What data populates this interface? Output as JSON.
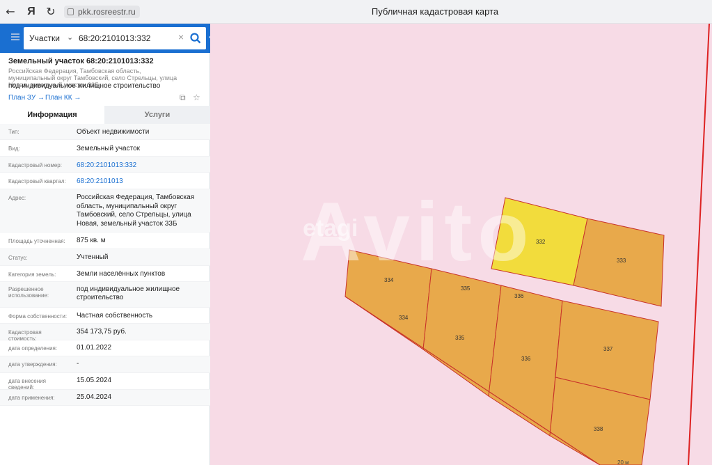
{
  "browser": {
    "url": "pkk.rosreestr.ru",
    "page_title": "Публичная кадастровая карта"
  },
  "search": {
    "type": "Участки",
    "value": "68:20:2101013:332"
  },
  "object": {
    "title": "Земельный участок 68:20:2101013:332",
    "address": "Российская Федерация, Тамбовская область, муниципальный округ Тамбовский, село Стрельцы, улица Новая, земельный участок 33Б",
    "use": "под индивидуальное жилищное строительство",
    "plan_zu": "План ЗУ →",
    "plan_kk": "План КК →"
  },
  "tabs": {
    "info": "Информация",
    "services": "Услуги"
  },
  "fields": [
    {
      "label": "Тип:",
      "value": "Объект недвижимости"
    },
    {
      "label": "Вид:",
      "value": "Земельный участок"
    },
    {
      "label": "Кадастровый номер:",
      "value": "68:20:2101013:332"
    },
    {
      "label": "Кадастровый квартал:",
      "value": "68:20:2101013"
    },
    {
      "label": "Адрес:",
      "value": "Российская Федерация, Тамбовская область, муниципальный округ Тамбовский, село Стрельцы, улица Новая, земельный участок 33Б"
    },
    {
      "label": "Площадь уточненная:",
      "value": "875 кв. м"
    },
    {
      "label": "Статус:",
      "value": "Учтенный"
    },
    {
      "label": "Категория земель:",
      "value": "Земли населённых пунктов"
    },
    {
      "label": "Разрешенное использование:",
      "value": "под индивидуальное жилищное строительство"
    },
    {
      "label": "Форма собственности:",
      "value": "Частная собственность"
    },
    {
      "label": "Кадастровая стоимость:",
      "value": "354 173,75 руб."
    },
    {
      "label": "дата определения:",
      "value": "01.01.2022"
    },
    {
      "label": "дата утверждения:",
      "value": "-"
    },
    {
      "label": "дата внесения сведений:",
      "value": "15.05.2024"
    },
    {
      "label": "дата применения:",
      "value": "25.04.2024"
    }
  ],
  "map": {
    "watermark": "Avito",
    "watermark2": "etagi",
    "scale": "20 м",
    "parcels": [
      "332",
      "333",
      "334",
      "334",
      "335",
      "335",
      "336",
      "336",
      "337",
      "338"
    ],
    "colors": {
      "background": "#f7dbe6",
      "parcel": "#e8a94b",
      "selected": "#f2dc3c",
      "border": "#c8322a"
    }
  }
}
